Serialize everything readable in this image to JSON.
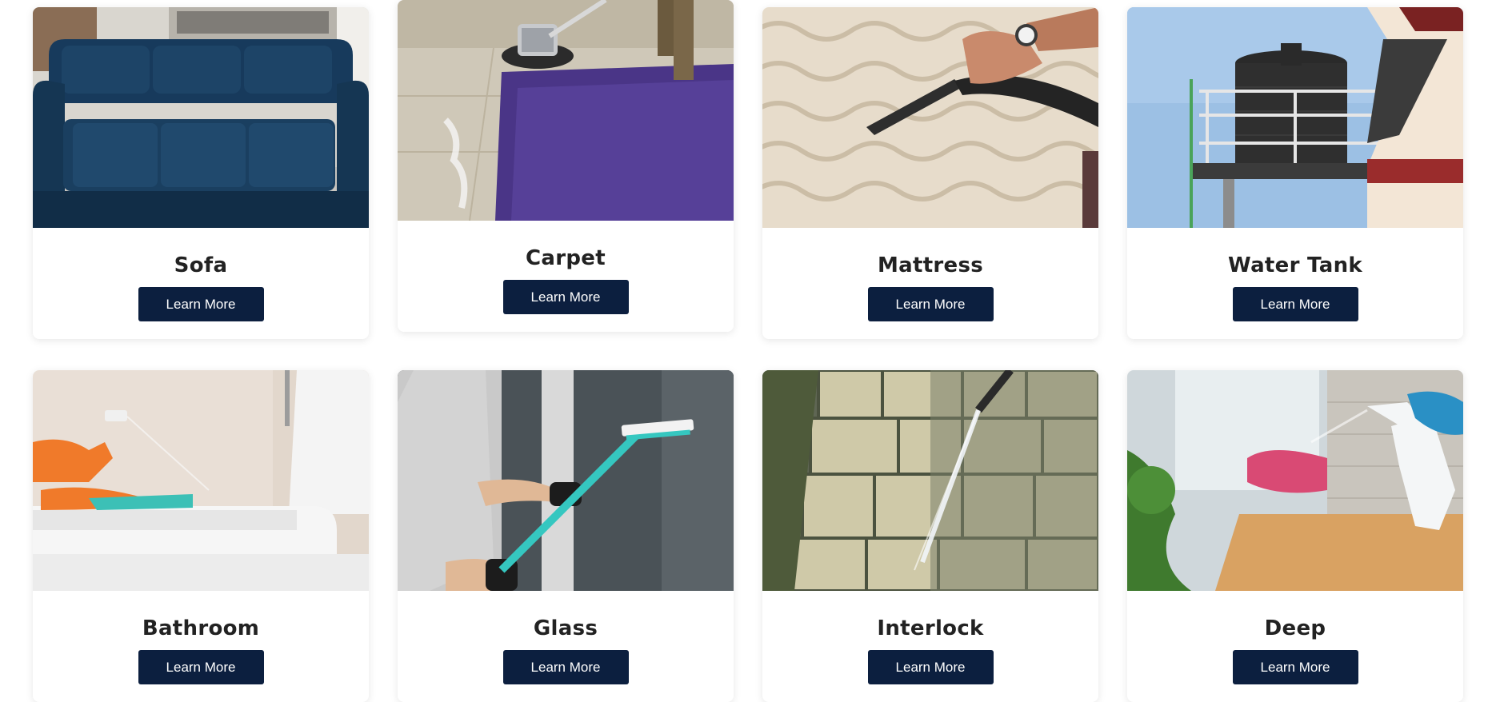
{
  "cards": [
    {
      "title": "Sofa",
      "button": "Learn More",
      "image": "blue-sofa-photo"
    },
    {
      "title": "Carpet",
      "button": "Learn More",
      "image": "purple-carpet-cleaning-photo"
    },
    {
      "title": "Mattress",
      "button": "Learn More",
      "image": "mattress-vacuum-photo"
    },
    {
      "title": "Water Tank",
      "button": "Learn More",
      "image": "rooftop-water-tank-photo"
    },
    {
      "title": "Bathroom",
      "button": "Learn More",
      "image": "toilet-cleaning-photo"
    },
    {
      "title": "Glass",
      "button": "Learn More",
      "image": "window-squeegee-photo"
    },
    {
      "title": "Interlock",
      "button": "Learn More",
      "image": "pressure-washing-pavers-photo"
    },
    {
      "title": "Deep",
      "button": "Learn More",
      "image": "spray-bottle-table-photo"
    }
  ],
  "colors": {
    "button_bg": "#0c1f3f",
    "button_text": "#ffffff",
    "title_text": "#222222",
    "card_bg": "#ffffff"
  }
}
